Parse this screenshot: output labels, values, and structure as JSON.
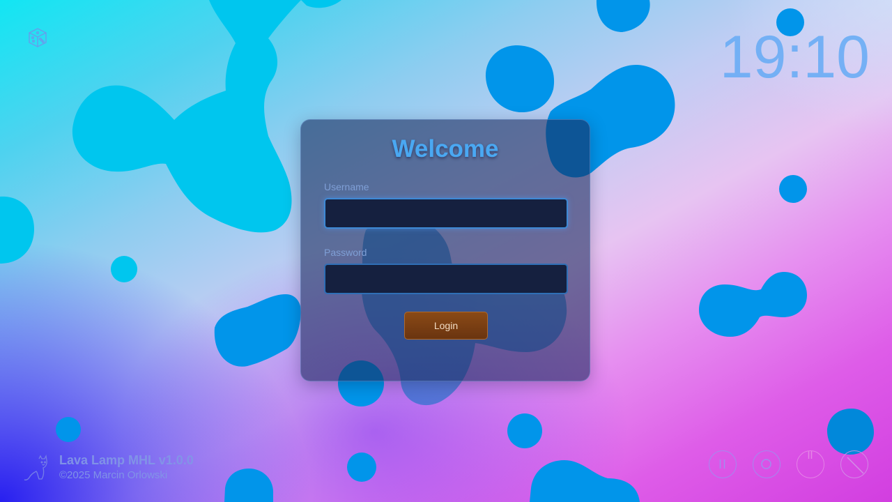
{
  "clock": {
    "time": "19:10"
  },
  "login_card": {
    "title": "Welcome",
    "username": {
      "label": "Username",
      "value": "",
      "placeholder": ""
    },
    "password": {
      "label": "Password",
      "value": "",
      "placeholder": ""
    },
    "login_label": "Login"
  },
  "footer": {
    "app_name": "Lava Lamp MHL v1.0.0",
    "copyright": "©2025 Marcin Orlowski",
    "logo_icon": "cat-icon"
  },
  "top_icons": {
    "dice_icon": "dice-icon"
  },
  "controls": [
    {
      "icon": "pause-icon",
      "color": "#9696f0"
    },
    {
      "icon": "stop-icon",
      "color": "#9696f0"
    },
    {
      "icon": "power-icon",
      "color": "#e68ce6"
    },
    {
      "icon": "exit-icon",
      "color": "#d296e6"
    }
  ],
  "colors": {
    "accent": "#4aa8f2",
    "button": "#7a3f14",
    "card": "#16285a"
  }
}
